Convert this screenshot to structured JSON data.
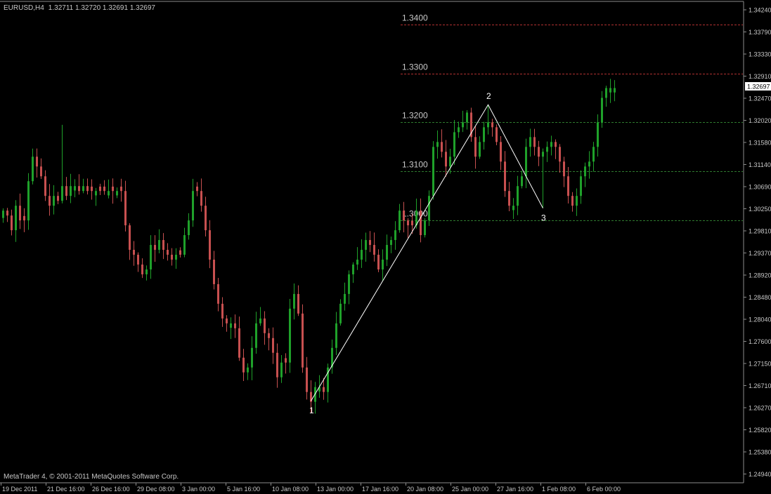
{
  "header": {
    "symbol": "EURUSD,H4",
    "ohlc": "1.32711 1.32720 1.32691 1.32697"
  },
  "footer": {
    "copyright": "MetaTrader 4, © 2001-2011 MetaQuotes Software Corp."
  },
  "price_axis": {
    "ticks": [
      "1.34240",
      "1.33790",
      "1.33330",
      "1.32910",
      "1.32470",
      "1.32020",
      "1.31580",
      "1.31140",
      "1.30690",
      "1.30250",
      "1.29810",
      "1.29370",
      "1.28920",
      "1.28480",
      "1.28040",
      "1.27600",
      "1.27150",
      "1.26710",
      "1.26270",
      "1.25820",
      "1.25380",
      "1.24940"
    ],
    "current_price": "1.32697"
  },
  "time_axis": {
    "labels": [
      "19 Dec 2011",
      "21 Dec 16:00",
      "26 Dec 16:00",
      "29 Dec 08:00",
      "3 Jan 00:00",
      "5 Jan 16:00",
      "10 Jan 08:00",
      "13 Jan 00:00",
      "17 Jan 16:00",
      "20 Jan 08:00",
      "25 Jan 00:00",
      "27 Jan 16:00",
      "1 Feb 08:00",
      "6 Feb 00:00"
    ]
  },
  "levels": [
    {
      "label": "1.3400",
      "price": 1.34,
      "color": "#b03030"
    },
    {
      "label": "1.3300",
      "price": 1.33,
      "color": "#b03030"
    },
    {
      "label": "1.3200",
      "price": 1.32,
      "color": "#2e7a2e"
    },
    {
      "label": "1.3100",
      "price": 1.31,
      "color": "#2e7a2e"
    },
    {
      "label": "1.3000",
      "price": 1.3,
      "color": "#2e7a2e"
    }
  ],
  "wave_labels": [
    {
      "text": "1",
      "price": 1.2632
    },
    {
      "text": "2",
      "price": 1.3236
    },
    {
      "text": "3",
      "price": 1.3025
    }
  ],
  "chart_data": {
    "type": "candlestick",
    "ylim": [
      1.2472,
      1.3431
    ],
    "colors": {
      "bull": "#1fa12a",
      "bear": "#c85050",
      "wave": "#ffffff"
    },
    "closes": [
      1.302,
      1.301,
      1.298,
      1.303,
      1.3,
      1.3,
      1.308,
      1.313,
      1.311,
      1.309,
      1.305,
      1.303,
      1.305,
      1.304,
      1.307,
      1.305,
      1.307,
      1.307,
      1.306,
      1.307,
      1.306,
      1.306,
      1.306,
      1.306,
      1.306,
      1.306,
      1.306,
      1.306,
      1.306,
      1.299,
      1.294,
      1.293,
      1.291,
      1.289,
      1.29,
      1.295,
      1.294,
      1.296,
      1.294,
      1.293,
      1.292,
      1.293,
      1.293,
      1.297,
      1.3,
      1.306,
      1.306,
      1.303,
      1.298,
      1.292,
      1.287,
      1.283,
      1.28,
      1.279,
      1.279,
      1.278,
      1.272,
      1.269,
      1.27,
      1.274,
      1.279,
      1.28,
      1.277,
      1.276,
      1.273,
      1.268,
      1.271,
      1.271,
      1.282,
      1.285,
      1.281,
      1.27,
      1.265,
      1.263,
      1.266,
      1.266,
      1.265,
      1.27,
      1.274,
      1.279,
      1.283,
      1.285,
      1.289,
      1.291,
      1.292,
      1.294,
      1.296,
      1.295,
      1.293,
      1.29,
      1.292,
      1.295,
      1.296,
      1.298,
      1.302,
      1.3,
      1.299,
      1.299,
      1.302,
      1.297,
      1.3,
      1.305,
      1.315,
      1.316,
      1.314,
      1.311,
      1.313,
      1.318,
      1.319,
      1.32,
      1.322,
      1.317,
      1.313,
      1.316,
      1.319,
      1.32,
      1.319,
      1.316,
      1.312,
      1.306,
      1.303,
      1.303,
      1.307,
      1.309,
      1.315,
      1.317,
      1.315,
      1.313,
      1.314,
      1.315,
      1.316,
      1.315,
      1.312,
      1.309,
      1.305,
      1.303,
      1.305,
      1.309,
      1.311,
      1.312,
      1.315,
      1.32,
      1.325,
      1.327,
      1.327,
      1.327
    ],
    "wave_points": [
      {
        "label": "1",
        "index": 73,
        "price": 1.2632
      },
      {
        "label": "2",
        "index": 115,
        "price": 1.3236
      },
      {
        "label": "3",
        "index": 128,
        "price": 1.3025
      }
    ]
  }
}
